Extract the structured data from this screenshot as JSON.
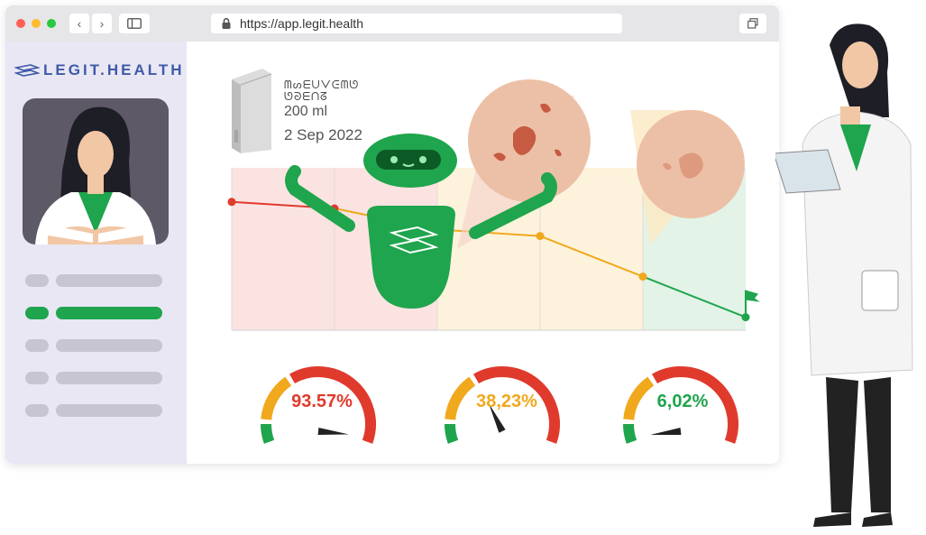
{
  "browser": {
    "url": "https://app.legit.health",
    "traffic_lights": [
      "#ff5f57",
      "#febc2e",
      "#28c840"
    ],
    "nav_back": "‹",
    "nav_forward": "›"
  },
  "sidebar": {
    "logo_text": "LEGIT.HEALTH",
    "nav_items": [
      {
        "state": "inactive"
      },
      {
        "state": "active"
      },
      {
        "state": "inactive"
      },
      {
        "state": "inactive"
      },
      {
        "state": "inactive"
      }
    ],
    "active_color": "#1fa54d"
  },
  "product": {
    "code_line1": "ᗰᔕᗴᑌᐯᕮᗰᘎ",
    "code_line2": "ᘎᘐᗴᑎᘔ",
    "volume": "200 ml",
    "date": "2 Sep 2022"
  },
  "chart_data": {
    "type": "line",
    "points": [
      {
        "x": 0,
        "y": 0.79,
        "color": "#e03a2d"
      },
      {
        "x": 1,
        "y": 0.75,
        "color": "#e03a2d"
      },
      {
        "x": 2,
        "y": 0.62,
        "color": "#f0a81d"
      },
      {
        "x": 3,
        "y": 0.58,
        "color": "#f0a81d"
      },
      {
        "x": 4,
        "y": 0.33,
        "color": "#f0a81d"
      },
      {
        "x": 5,
        "y": 0.08,
        "color": "#1fa54d"
      }
    ],
    "bands": [
      "#fbe3e1",
      "#fbe3e1",
      "#fdf3dc",
      "#fdf3dc",
      "#e3f3e7"
    ]
  },
  "gauges": [
    {
      "value_text": "93.57%",
      "value": 93.57,
      "color": "#e03a2d"
    },
    {
      "value_text": "38,23%",
      "value": 38.23,
      "color": "#f0a81d"
    },
    {
      "value_text": "6,02%",
      "value": 6.02,
      "color": "#1fa54d"
    }
  ],
  "icons": {
    "lock": "lock-icon",
    "sidebar_toggle": "sidebar-toggle-icon",
    "tabs": "tabs-icon",
    "flag": "flag-icon"
  }
}
